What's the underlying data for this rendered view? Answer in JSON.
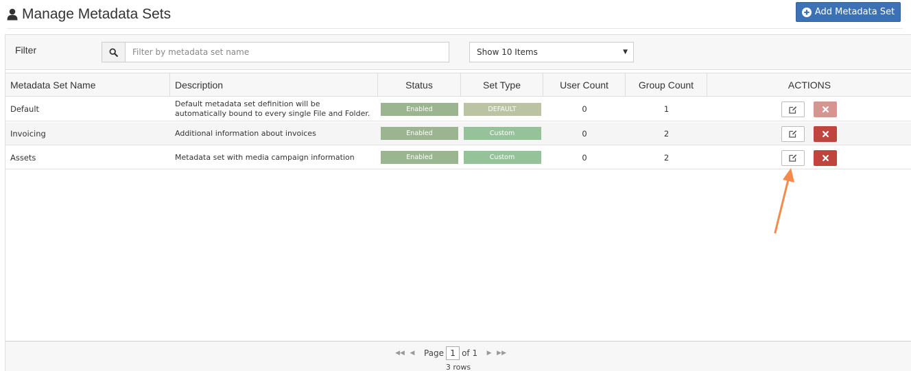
{
  "header": {
    "title": "Manage Metadata Sets",
    "add_button_label": "Add Metadata Set"
  },
  "filter": {
    "label": "Filter",
    "search_placeholder": "Filter by metadata set name",
    "page_size_selected": "Show 10 Items"
  },
  "table": {
    "columns": [
      "Metadata Set Name",
      "Description",
      "Status",
      "Set Type",
      "User Count",
      "Group Count",
      "ACTIONS"
    ],
    "rows": [
      {
        "name": "Default",
        "description_lines": [
          "Default metadata set definition will be",
          "automatically bound to every single File and Folder."
        ],
        "status": "Enabled",
        "set_type": "DEFAULT",
        "user_count": "0",
        "group_count": "1",
        "delete_enabled": false
      },
      {
        "name": "Invoicing",
        "description_lines": [
          "Additional information about invoices"
        ],
        "status": "Enabled",
        "set_type": "Custom",
        "user_count": "0",
        "group_count": "2",
        "delete_enabled": true
      },
      {
        "name": "Assets",
        "description_lines": [
          "Metadata set with media campaign information"
        ],
        "status": "Enabled",
        "set_type": "Custom",
        "user_count": "0",
        "group_count": "2",
        "delete_enabled": true
      }
    ]
  },
  "pager": {
    "page_label": "Page",
    "current_page": "1",
    "of_label": "of 1",
    "row_count": "3 rows"
  },
  "colors": {
    "primary": "#3d71b5",
    "danger": "#c0453f",
    "status_enabled": "#9cb591",
    "type_custom": "#96c29a",
    "type_default": "#bcc3a3",
    "annotation_arrow": "#f58a4b"
  },
  "icons": {
    "title": "user-icon",
    "add": "plus-circle-icon",
    "search": "search-icon",
    "edit": "edit-icon",
    "delete": "close-icon",
    "pager": [
      "first-page-icon",
      "prev-page-icon",
      "next-page-icon",
      "last-page-icon"
    ]
  }
}
